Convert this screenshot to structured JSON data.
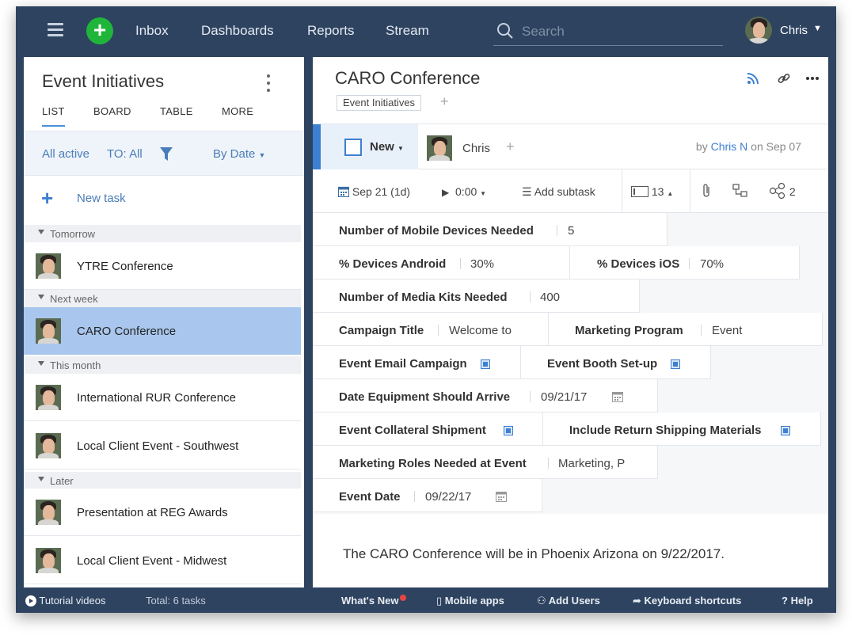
{
  "nav": {
    "items": [
      "Inbox",
      "Dashboards",
      "Reports",
      "Stream"
    ],
    "search_placeholder": "Search",
    "user_name": "Chris"
  },
  "left": {
    "title": "Event Initiatives",
    "tabs": [
      "LIST",
      "BOARD",
      "TABLE",
      "MORE"
    ],
    "filter": {
      "status": "All active",
      "to": "TO: All",
      "sort": "By Date"
    },
    "new_task": "New task",
    "groups": [
      {
        "label": "Tomorrow",
        "tasks": [
          "YTRE Conference"
        ]
      },
      {
        "label": "Next week",
        "tasks": [
          "CARO Conference"
        ]
      },
      {
        "label": "This month",
        "tasks": [
          "International RUR Conference",
          "Local Client Event - Southwest"
        ]
      },
      {
        "label": "Later",
        "tasks": [
          "Presentation at REG Awards",
          "Local Client Event - Midwest"
        ]
      }
    ],
    "selected_task": "CARO Conference"
  },
  "task": {
    "title": "CARO Conference",
    "folder_tag": "Event Initiatives",
    "status": "New",
    "assignee": "Chris",
    "by_prefix": "by",
    "author": "Chris N",
    "date_prefix": "on Sep 07",
    "toolbar": {
      "date": "Sep 21 (1d)",
      "time": "0:00",
      "add_subtask": "Add subtask",
      "priority_count": "13",
      "share_count": "2"
    },
    "fields": {
      "mobile_devices_label": "Number of Mobile Devices Needed",
      "mobile_devices_value": "5",
      "android_label": "% Devices Android",
      "android_value": "30%",
      "ios_label": "% Devices iOS",
      "ios_value": "70%",
      "media_kits_label": "Number of Media Kits Needed",
      "media_kits_value": "400",
      "campaign_title_label": "Campaign Title",
      "campaign_title_value": "Welcome to",
      "marketing_program_label": "Marketing Program",
      "marketing_program_value": "Event",
      "email_campaign_label": "Event Email Campaign",
      "booth_label": "Event Booth Set-up",
      "equipment_date_label": "Date Equipment Should Arrive",
      "equipment_date_value": "09/21/17",
      "collateral_label": "Event Collateral Shipment",
      "return_shipping_label": "Include Return Shipping Materials",
      "roles_label": "Marketing Roles Needed at Event",
      "roles_value": "Marketing, P",
      "event_date_label": "Event Date",
      "event_date_value": "09/22/17"
    },
    "description": "The CARO Conference will be in Phoenix Arizona on 9/22/2017."
  },
  "footer": {
    "tutorial": "Tutorial videos",
    "total": "Total: 6 tasks",
    "whats_new": "What's New",
    "mobile_apps": "Mobile apps",
    "add_users": "Add Users",
    "shortcuts": "Keyboard shortcuts",
    "help": "Help"
  },
  "colors": {
    "accent": "#3d7fd0",
    "topbar": "#2e4360",
    "add_button": "#1fb53a",
    "selected_row": "#a9c7ee"
  },
  "icons": [
    "hamburger-icon",
    "plus-icon",
    "search-icon",
    "caret-down-icon",
    "kebab-icon",
    "filter-icon",
    "rss-icon",
    "link-icon",
    "more-icon",
    "calendar-icon",
    "play-icon",
    "subtask-icon",
    "priority-icon",
    "attachment-icon",
    "dependency-icon",
    "share-icon",
    "play-circle-icon",
    "mobile-icon",
    "add-users-icon",
    "shortcut-icon"
  ]
}
